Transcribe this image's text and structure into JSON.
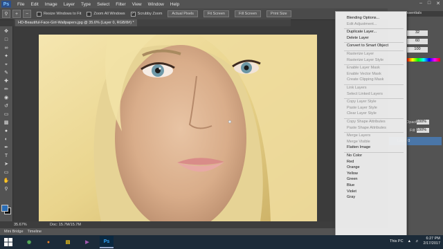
{
  "menubar": {
    "logo": "Ps",
    "items": [
      "File",
      "Edit",
      "Image",
      "Layer",
      "Type",
      "Select",
      "Filter",
      "View",
      "Window",
      "Help"
    ]
  },
  "options_bar": {
    "resize_windows": "Resize Windows to Fit",
    "zoom_all": "Zoom All Windows",
    "scrubby_zoom": "Scrubby Zoom",
    "actual_pixels": "Actual Pixels",
    "fit_screen": "Fit Screen",
    "fill_screen": "Fill Screen",
    "print_size": "Print Size",
    "essentials": "Essentials"
  },
  "document_tab": "HD-Beautiful-Face-Girl-Wallpapers.jpg @ 35.6% (Layer 0, RGB/8#) *",
  "status": {
    "zoom": "35.67%",
    "doc": "Doc: 15.7M/15.7M"
  },
  "mini_bridge": {
    "tab1": "Mini Bridge",
    "tab2": "Timeline"
  },
  "right_panel": {
    "opacity_label": "Opacity:",
    "opacity_value": "100%",
    "fill_label": "Fill:",
    "fill_value": "100%",
    "layer_name": "Layer 0",
    "values": [
      "32",
      "60",
      "100"
    ]
  },
  "context_menu": {
    "items": [
      {
        "label": "Blending Options...",
        "enabled": true
      },
      {
        "label": "Edit Adjustment...",
        "enabled": false
      },
      {
        "sep": true
      },
      {
        "label": "Duplicate Layer...",
        "enabled": true
      },
      {
        "label": "Delete Layer",
        "enabled": true
      },
      {
        "sep": true
      },
      {
        "label": "Convert to Smart Object",
        "enabled": true
      },
      {
        "sep": true
      },
      {
        "label": "Rasterize Layer",
        "enabled": false
      },
      {
        "label": "Rasterize Layer Style",
        "enabled": false
      },
      {
        "sep": true
      },
      {
        "label": "Enable Layer Mask",
        "enabled": false
      },
      {
        "label": "Enable Vector Mask",
        "enabled": false
      },
      {
        "label": "Create Clipping Mask",
        "enabled": false
      },
      {
        "sep": true
      },
      {
        "label": "Link Layers",
        "enabled": false
      },
      {
        "label": "Select Linked Layers",
        "enabled": false
      },
      {
        "sep": true
      },
      {
        "label": "Copy Layer Style",
        "enabled": false
      },
      {
        "label": "Paste Layer Style",
        "enabled": false
      },
      {
        "label": "Clear Layer Style",
        "enabled": false
      },
      {
        "sep": true
      },
      {
        "label": "Copy Shape Attributes",
        "enabled": false
      },
      {
        "label": "Paste Shape Attributes",
        "enabled": false
      },
      {
        "sep": true
      },
      {
        "label": "Merge Layers",
        "enabled": false
      },
      {
        "label": "Merge Visible",
        "enabled": false
      },
      {
        "label": "Flatten Image",
        "enabled": true
      },
      {
        "sep": true
      },
      {
        "label": "No Color",
        "enabled": true
      },
      {
        "label": "Red",
        "enabled": true
      },
      {
        "label": "Orange",
        "enabled": true
      },
      {
        "label": "Yellow",
        "enabled": true
      },
      {
        "label": "Green",
        "enabled": true
      },
      {
        "label": "Blue",
        "enabled": true
      },
      {
        "label": "Violet",
        "enabled": true
      },
      {
        "label": "Gray",
        "enabled": true
      }
    ]
  },
  "taskbar": {
    "this_pc": "This PC",
    "time": "6:27 PM",
    "date": "2/17/2017"
  },
  "colors": {
    "accent": "#2a6db5",
    "ui_dark": "#535353",
    "taskbar": "#1c2b39"
  }
}
